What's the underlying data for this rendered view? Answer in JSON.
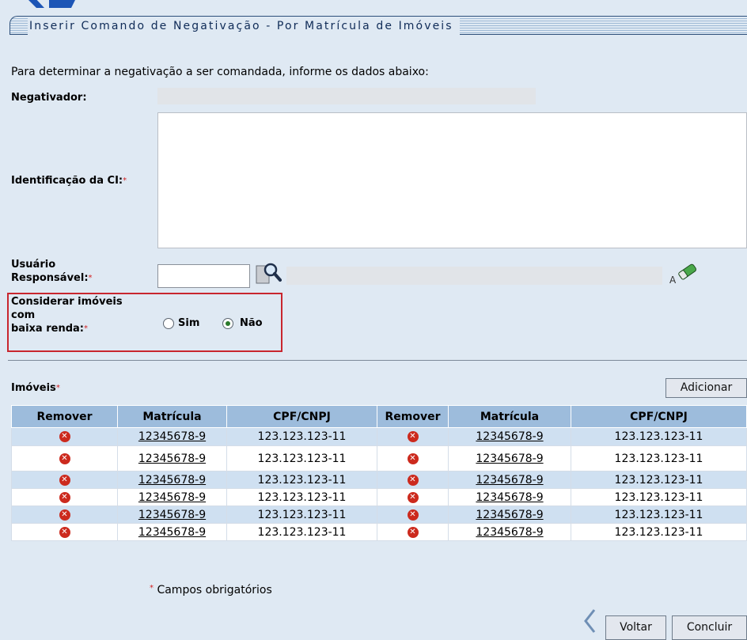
{
  "page": {
    "title": "Inserir Comando de Negativação - Por Matrícula de Imóveis",
    "intro": "Para determinar a negativação a ser comandada, informe os dados abaixo:",
    "required_mark": "*"
  },
  "form": {
    "negativador_label": "Negativador:",
    "identificacao_label": "Identificação da CI:",
    "usuario_label_line1": "Usuário",
    "usuario_label_line2": "Responsável:",
    "usuario_value": "",
    "baixa_renda_line1": "Considerar imóveis",
    "baixa_renda_line2": "com",
    "baixa_renda_line3": "baixa renda:",
    "option_sim": "Sim",
    "option_nao": "Não",
    "selected": "Não"
  },
  "imoveis": {
    "label": "Imóveis",
    "add_button": "Adicionar",
    "columns": [
      "Remover",
      "Matrícula",
      "CPF/CNPJ",
      "Remover",
      "Matrícula",
      "CPF/CNPJ"
    ],
    "rows": [
      {
        "mat1": "12345678-9",
        "cpf1": "123.123.123-11",
        "mat2": "12345678-9",
        "cpf2": "123.123.123-11"
      },
      {
        "mat1": "12345678-9",
        "cpf1": "123.123.123-11",
        "mat2": "12345678-9",
        "cpf2": "123.123.123-11"
      },
      {
        "mat1": "12345678-9",
        "cpf1": "123.123.123-11",
        "mat2": "12345678-9",
        "cpf2": "123.123.123-11"
      },
      {
        "mat1": "12345678-9",
        "cpf1": "123.123.123-11",
        "mat2": "12345678-9",
        "cpf2": "123.123.123-11"
      },
      {
        "mat1": "12345678-9",
        "cpf1": "123.123.123-11",
        "mat2": "12345678-9",
        "cpf2": "123.123.123-11"
      },
      {
        "mat1": "12345678-9",
        "cpf1": "123.123.123-11",
        "mat2": "12345678-9",
        "cpf2": "123.123.123-11"
      }
    ]
  },
  "footer": {
    "required_note": "Campos obrigatórios",
    "back_button": "Voltar",
    "finish_button": "Concluir"
  },
  "colors": {
    "background": "#dfe9f3",
    "header_row": "#9dbcdc",
    "alt_row": "#cfe0f1",
    "highlight_border": "#c8262e",
    "remove_icon": "#cc2a1e"
  }
}
